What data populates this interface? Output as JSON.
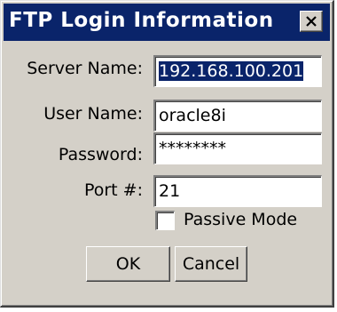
{
  "window": {
    "title": "FTP Login Information",
    "close_icon": "close-x-icon"
  },
  "form": {
    "server": {
      "label": "Server Name:",
      "value": "192.168.100.201",
      "selected": true
    },
    "user": {
      "label": "User Name:",
      "value": "oracle8i"
    },
    "password": {
      "label": "Password:",
      "value": "********"
    },
    "port": {
      "label": "Port #:",
      "value": "21"
    },
    "passive": {
      "label": "Passive Mode",
      "checked": false
    }
  },
  "buttons": {
    "ok_label": "OK",
    "cancel_label": "Cancel"
  },
  "colors": {
    "titlebar": "#0a246a",
    "face": "#d4d0c8",
    "selection": "#0a246a"
  }
}
